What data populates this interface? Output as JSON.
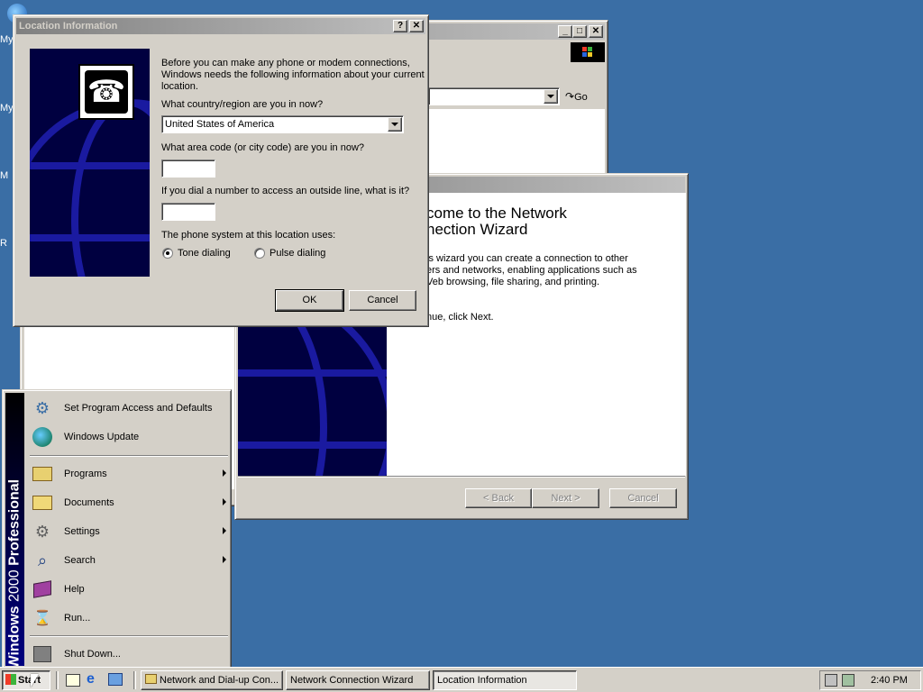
{
  "desktop": {
    "labels": [
      "My",
      "My",
      "M",
      "R"
    ]
  },
  "explorer_window": {
    "go_label": "Go"
  },
  "wizard": {
    "heading_line1": "come to the Network",
    "heading_line2": "nection Wizard",
    "para_line1": "is wizard you can create a connection to other",
    "para_line2": "ers and networks, enabling applications such as",
    "para_line3": "Veb browsing, file sharing, and printing.",
    "continue_text": "nue, click Next.",
    "back_label": "< Back",
    "next_label": "Next >",
    "cancel_label": "Cancel"
  },
  "location_dialog": {
    "title": "Location Information",
    "help_btn": "?",
    "close_btn": "✕",
    "intro_line1": "Before you can make any phone or modem connections,",
    "intro_line2": "Windows needs the following information about your current",
    "intro_line3": "location.",
    "country_label": "What country/region are you in now?",
    "country_value": "United States of America",
    "area_code_label": "What area code (or city code) are you in now?",
    "area_code_value": "",
    "outside_line_label": "If you dial a number to access an outside line, what is it?",
    "outside_line_value": "",
    "phone_system_label": "The phone system at this location uses:",
    "tone_label": "Tone dialing",
    "pulse_label": "Pulse dialing",
    "tone_selected": true,
    "ok_label": "OK",
    "cancel_label": "Cancel"
  },
  "start_menu": {
    "banner_text": "Windows 2000 Professional",
    "banner_brand": "Windows",
    "banner_version": "2000",
    "banner_edition": "Professional",
    "items": [
      {
        "label": "Set Program Access and Defaults",
        "icon": "program-access-icon"
      },
      {
        "label": "Windows Update",
        "icon": "windows-update-icon"
      },
      {
        "label": "Programs",
        "icon": "programs-icon",
        "submenu": true
      },
      {
        "label": "Documents",
        "icon": "documents-icon",
        "submenu": true
      },
      {
        "label": "Settings",
        "icon": "settings-icon",
        "submenu": true
      },
      {
        "label": "Search",
        "icon": "search-icon",
        "submenu": true
      },
      {
        "label": "Help",
        "icon": "help-icon"
      },
      {
        "label": "Run...",
        "icon": "run-icon"
      },
      {
        "label": "Shut Down...",
        "icon": "shutdown-icon"
      }
    ]
  },
  "taskbar": {
    "start_label": "Start",
    "tasks": [
      {
        "label": "Network and Dial-up Con..."
      },
      {
        "label": "Network Connection Wizard"
      },
      {
        "label": "Location Information"
      }
    ],
    "clock": "2:40 PM"
  },
  "colors": {
    "desktop": "#3a6ea5",
    "active_title": "#0a246a",
    "face": "#d4d0c8",
    "banner_dark": "#000040"
  }
}
